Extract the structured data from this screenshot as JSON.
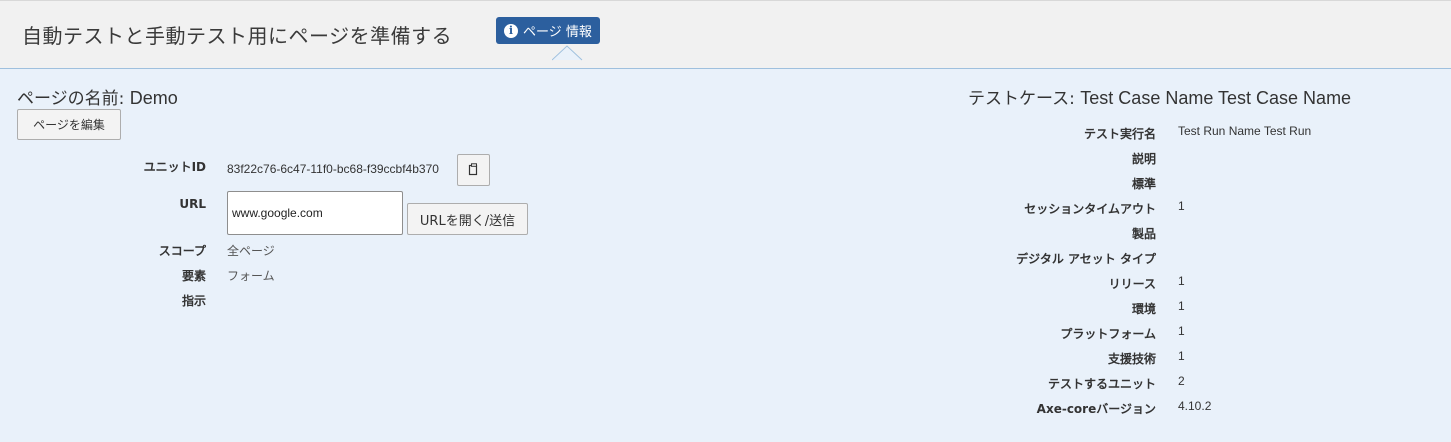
{
  "header": {
    "title": "自動テストと手動テスト用にページを準備する",
    "info_button": "ページ 情報",
    "info_icon": "info-icon"
  },
  "page": {
    "name_label": "ページの名前:",
    "name_value": "Demo",
    "edit_button": "ページを編集",
    "fields": {
      "unit_id_label": "ユニットID",
      "unit_id_value": "83f22c76-6c47-11f0-bc68-f39ccbf4b370",
      "url_label": "URL",
      "url_value": "www.google.com",
      "open_button": "URLを開く/送信",
      "scope_label": "スコープ",
      "scope_value": "全ページ",
      "element_label": "要素",
      "element_value": "フォーム",
      "instruction_label": "指示"
    }
  },
  "testcase": {
    "title_label": "テストケース:",
    "title_value": "Test Case Name Test Case Name",
    "rows": [
      {
        "label": "テスト実行名",
        "value": "Test Run Name Test Run"
      },
      {
        "label": "説明",
        "value": ""
      },
      {
        "label": "標準",
        "value": ""
      },
      {
        "label": "セッションタイムアウト",
        "value": "1"
      },
      {
        "label": "製品",
        "value": ""
      },
      {
        "label": "デジタル アセット タイプ",
        "value": ""
      },
      {
        "label": "リリース",
        "value": "1"
      },
      {
        "label": "環境",
        "value": "1"
      },
      {
        "label": "プラットフォーム",
        "value": "1"
      },
      {
        "label": "支援技術",
        "value": "1"
      },
      {
        "label": "テストするユニット",
        "value": "2"
      },
      {
        "label": "Axe-coreバージョン",
        "value": "4.10.2"
      }
    ]
  },
  "colors": {
    "header_bg": "#f1f1f1",
    "body_bg": "#e9f1fa",
    "accent": "#2c5f9e"
  }
}
